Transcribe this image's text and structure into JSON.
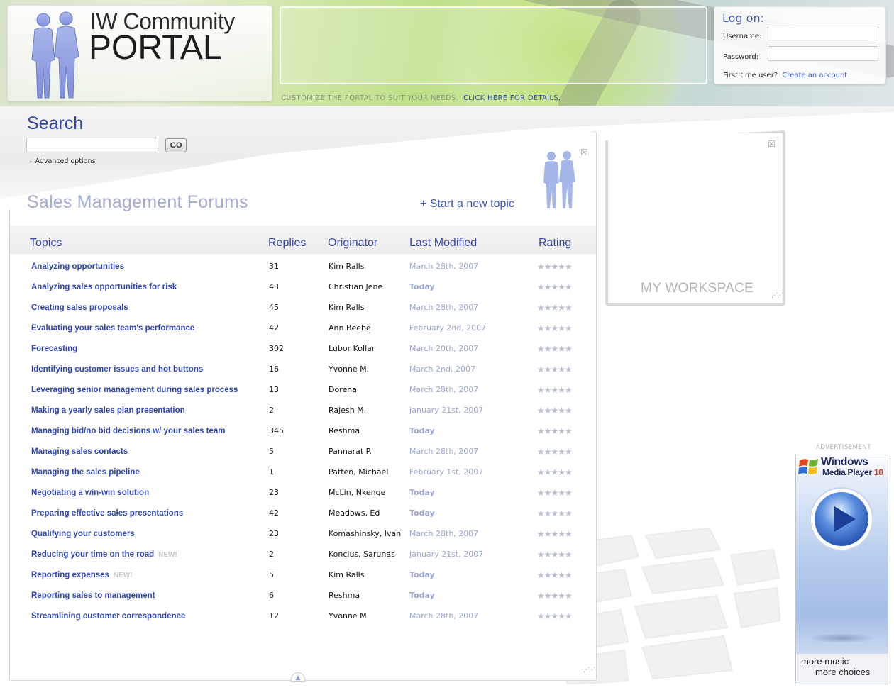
{
  "header": {
    "logo_line1": "IW Community",
    "logo_line2": "PORTAL",
    "promo_text": "CUSTOMIZE THE PORTAL TO SUIT YOUR NEEDS.",
    "promo_link": "CLICK HERE FOR DETAILS."
  },
  "login": {
    "title": "Log on:",
    "username_label": "Username:",
    "password_label": "Password:",
    "first_time": "First time user?",
    "create_link": "Create an account."
  },
  "search": {
    "title": "Search",
    "go_label": "GO",
    "advanced": "Advanced options"
  },
  "forum": {
    "title": "Sales Management Forums",
    "new_topic": "+ Start a new topic",
    "columns": {
      "topics": "Topics",
      "replies": "Replies",
      "originator": "Originator",
      "last_modified": "Last Modified",
      "rating": "Rating"
    },
    "new_badge": "NEW!",
    "rating_glyphs": "★★★★★",
    "rows": [
      {
        "topic": "Analyzing opportunities",
        "replies": "31",
        "originator": "Kim Ralls",
        "modified": "March 28th, 2007",
        "today": false,
        "new": false
      },
      {
        "topic": "Analyzing sales opportunities for risk",
        "replies": "43",
        "originator": "Christian Jene",
        "modified": "Today",
        "today": true,
        "new": false
      },
      {
        "topic": "Creating sales proposals",
        "replies": "45",
        "originator": "Kim Ralls",
        "modified": "March 28th, 2007",
        "today": false,
        "new": false
      },
      {
        "topic": "Evaluating your sales team's performance",
        "replies": "42",
        "originator": "Ann Beebe",
        "modified": "February 2nd, 2007",
        "today": false,
        "new": false
      },
      {
        "topic": "Forecasting",
        "replies": "302",
        "originator": "Lubor Kollar",
        "modified": "March 20th, 2007",
        "today": false,
        "new": false
      },
      {
        "topic": "Identifying customer issues and hot buttons",
        "replies": "16",
        "originator": "Yvonne M.",
        "modified": "March 2nd, 2007",
        "today": false,
        "new": false
      },
      {
        "topic": "Leveraging senior management during sales process",
        "replies": "13",
        "originator": "Dorena",
        "modified": "March 28th, 2007",
        "today": false,
        "new": false
      },
      {
        "topic": "Making a yearly sales plan presentation",
        "replies": "2",
        "originator": "Rajesh M.",
        "modified": "January 21st, 2007",
        "today": false,
        "new": false
      },
      {
        "topic": "Managing bid/no bid decisions w/ your sales team",
        "replies": "345",
        "originator": "Reshma",
        "modified": "Today",
        "today": true,
        "new": false
      },
      {
        "topic": "Managing sales contacts",
        "replies": "5",
        "originator": "Pannarat P.",
        "modified": "March 28th, 2007",
        "today": false,
        "new": false
      },
      {
        "topic": "Managing the sales pipeline",
        "replies": "1",
        "originator": "Patten, Michael",
        "modified": "February 1st, 2007",
        "today": false,
        "new": false
      },
      {
        "topic": "Negotiating a win-win solution",
        "replies": "23",
        "originator": "McLin, Nkenge",
        "modified": "Today",
        "today": true,
        "new": false
      },
      {
        "topic": "Preparing effective sales presentations",
        "replies": "42",
        "originator": "Meadows, Ed",
        "modified": "Today",
        "today": true,
        "new": false
      },
      {
        "topic": "Qualifying your customers",
        "replies": "23",
        "originator": "Komashinsky, Ivan",
        "modified": "March 28th, 2007",
        "today": false,
        "new": false
      },
      {
        "topic": "Reducing your time on the road",
        "replies": "2",
        "originator": "Koncius, Sarunas",
        "modified": "January 21st, 2007",
        "today": false,
        "new": true
      },
      {
        "topic": "Reporting expenses",
        "replies": "5",
        "originator": "Kim Ralls",
        "modified": "Today",
        "today": true,
        "new": true
      },
      {
        "topic": "Reporting sales to management",
        "replies": "6",
        "originator": "Reshma",
        "modified": "Today",
        "today": true,
        "new": false
      },
      {
        "topic": "Streamlining customer correspondence",
        "replies": "12",
        "originator": "Yvonne M.",
        "modified": "March 28th, 2007",
        "today": false,
        "new": false
      }
    ]
  },
  "workspace": {
    "label": "MY WORKSPACE"
  },
  "ad": {
    "label": "ADVERTISEMENT",
    "brand_line1": "Windows",
    "brand_line2": "Media Player",
    "version": "10",
    "foot1": "more music",
    "foot2": "more choices"
  },
  "icons": {
    "close": "close-icon",
    "grip": "resize-grip-icon",
    "play": "play-icon"
  },
  "colors": {
    "accent_blue": "#3447a8",
    "link_blue": "#2f45b2",
    "muted_date": "#9aa6d3"
  }
}
